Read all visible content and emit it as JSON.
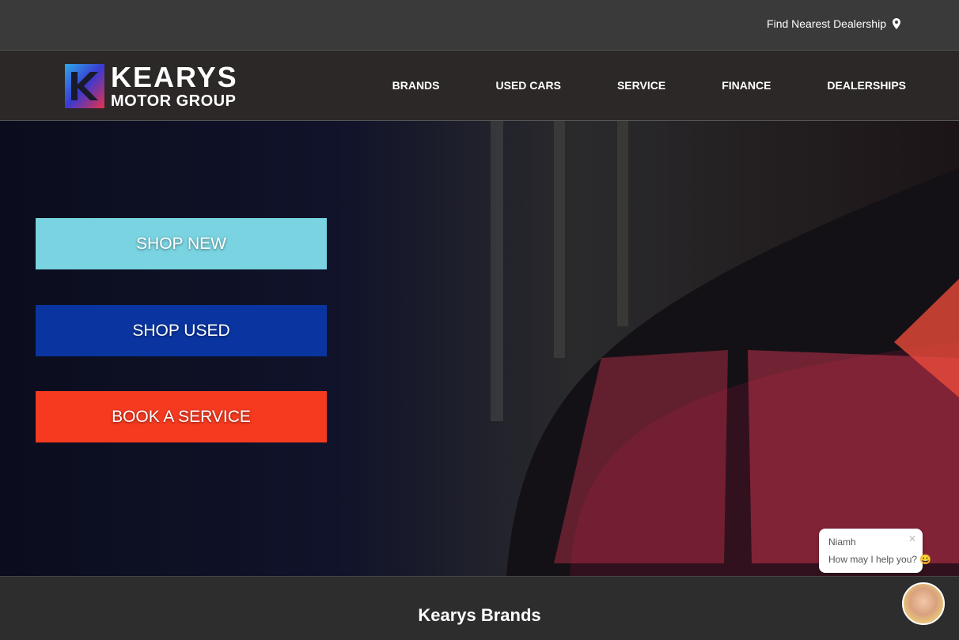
{
  "topbar": {
    "find_dealership": "Find Nearest Dealership",
    "icon": "map-pin-icon"
  },
  "logo": {
    "line1": "KEARYS",
    "line2": "MOTOR GROUP"
  },
  "nav": {
    "items": [
      "BRANDS",
      "USED CARS",
      "SERVICE",
      "FINANCE",
      "DEALERSHIPS"
    ]
  },
  "hero": {
    "buttons": {
      "shop_new": "SHOP NEW",
      "shop_used": "SHOP USED",
      "book_service": "BOOK A SERVICE"
    },
    "colors": {
      "shop_new": "#79d3e0",
      "shop_used": "#0a35a0",
      "book_service": "#f53a20"
    }
  },
  "brands": {
    "title": "Kearys Brands"
  },
  "chat": {
    "agent_name": "Niamh",
    "message": "How may I help you? 😀"
  }
}
